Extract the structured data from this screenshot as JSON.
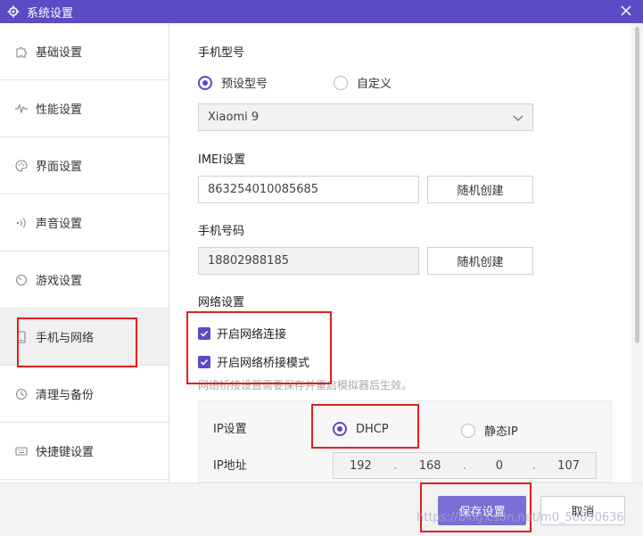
{
  "window": {
    "title": "系统设置"
  },
  "sidebar": {
    "items": [
      {
        "label": "基础设置",
        "icon": "puzzle-icon"
      },
      {
        "label": "性能设置",
        "icon": "pulse-icon"
      },
      {
        "label": "界面设置",
        "icon": "palette-icon"
      },
      {
        "label": "声音设置",
        "icon": "sound-icon"
      },
      {
        "label": "游戏设置",
        "icon": "game-icon"
      },
      {
        "label": "手机与网络",
        "icon": "phone-icon",
        "active": true
      },
      {
        "label": "清理与备份",
        "icon": "clock-icon"
      },
      {
        "label": "快捷键设置",
        "icon": "keyboard-icon"
      }
    ]
  },
  "phone_model": {
    "title": "手机型号",
    "option_preset": "预设型号",
    "option_custom": "自定义",
    "selected_model": "Xiaomi 9"
  },
  "imei": {
    "title": "IMEI设置",
    "value": "863254010085685",
    "random_button": "随机创建"
  },
  "phone_number": {
    "title": "手机号码",
    "value": "18802988185",
    "random_button": "随机创建"
  },
  "network": {
    "title": "网络设置",
    "enable_connection": "开启网络连接",
    "enable_bridge": "开启网络桥接模式",
    "hint": "网络桥接设置需要保存并重启模拟器后生效。",
    "ip_settings_label": "IP设置",
    "option_dhcp": "DHCP",
    "option_static": "静态IP",
    "ip_address_label": "IP地址",
    "ip": [
      "192",
      "168",
      "0",
      "107"
    ]
  },
  "footer": {
    "save_button": "保存设置",
    "cancel_button": "取消"
  },
  "watermark": "https://blog.csdn.net/m0_50890636",
  "colors": {
    "accent": "#5b4bc4",
    "annotation": "#e0201f"
  }
}
